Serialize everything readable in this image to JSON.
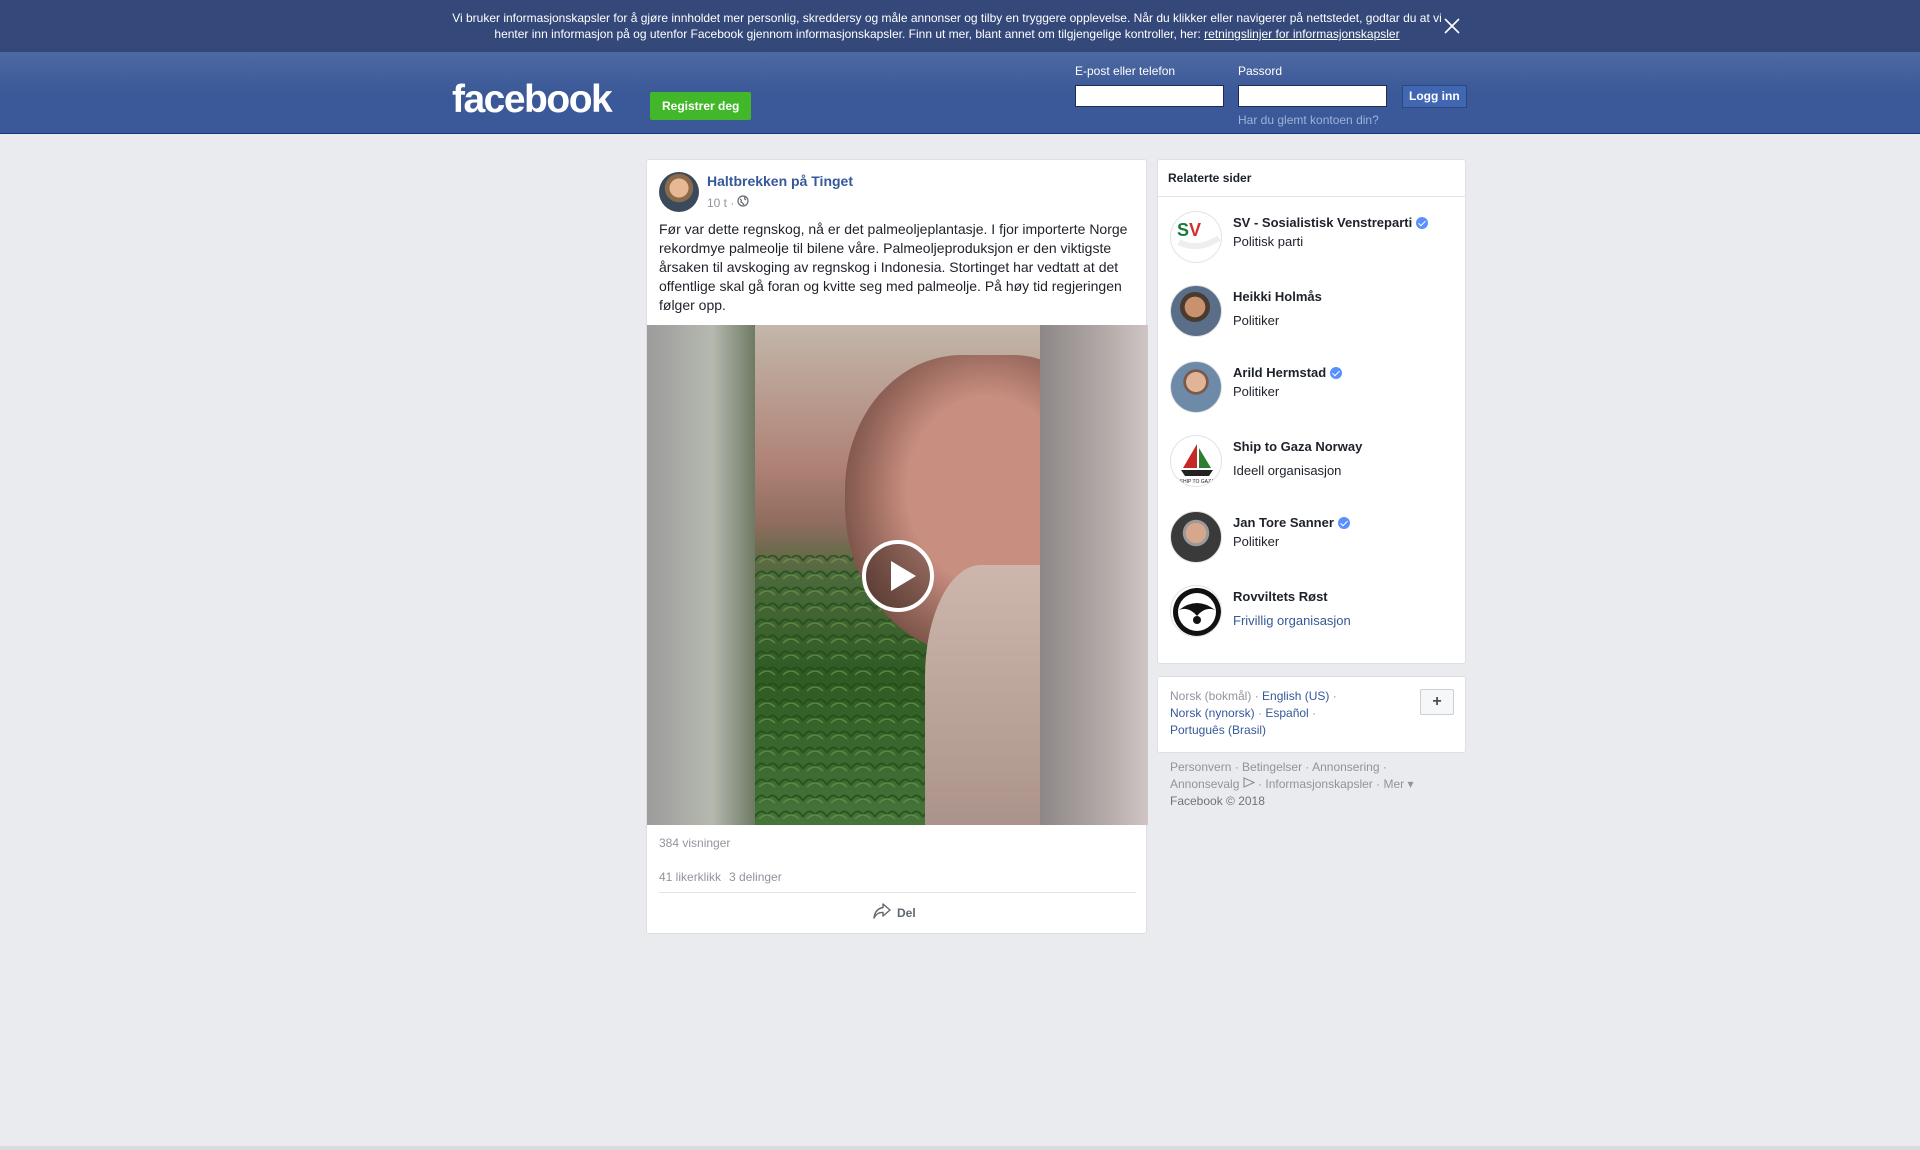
{
  "cookie_banner": {
    "text": "Vi bruker informasjonskapsler for å gjøre innholdet mer personlig, skreddersy og måle annonser og tilby en tryggere opplevelse. Når du klikker eller navigerer på nettstedet, godtar du at vi henter inn informasjon på og utenfor Facebook gjennom informasjonskapsler. Finn ut mer, blant annet om tilgjengelige kontroller, her: ",
    "link": "retningslinjer for informasjonskapsler"
  },
  "header": {
    "logo": "facebook",
    "register_label": "Registrer deg",
    "email_label": "E-post eller telefon",
    "password_label": "Passord",
    "login_label": "Logg inn",
    "forgot_label": "Har du glemt kontoen din?"
  },
  "post": {
    "author": "Haltbrekken på Tinget",
    "time": "10 t ·",
    "text": "Før var dette regnskog, nå er det palmeoljeplantasje. I fjor importerte Norge rekordmye palmeolje til bilene våre. Palmeoljeproduksjon er den viktigste årsaken til avskoging av regnskog i Indonesia. Stortinget har vedtatt at det offentlige skal gå foran og kvitte seg med palmeolje. På høy tid regjeringen følger opp.",
    "views": "384 visninger",
    "likes": "41 likerklikk",
    "shares": "3 delinger",
    "share_label": "Del"
  },
  "related": {
    "title": "Relaterte sider",
    "items": [
      {
        "name": "SV - Sosialistisk Venstreparti",
        "sub": "Politisk parti",
        "verified": true
      },
      {
        "name": "Heikki Holmås",
        "sub": "Politiker",
        "verified": false
      },
      {
        "name": "Arild Hermstad",
        "sub": "Politiker",
        "verified": true
      },
      {
        "name": "Ship to Gaza Norway",
        "sub": "Ideell organisasjon",
        "verified": false
      },
      {
        "name": "Jan Tore Sanner",
        "sub": "Politiker",
        "verified": true
      },
      {
        "name": "Rovviltets Røst",
        "sub": "Frivillig organisasjon",
        "verified": false
      }
    ]
  },
  "languages": {
    "current": "Norsk (bokmål)",
    "english": "English (US)",
    "nynorsk": "Norsk (nynorsk)",
    "espanol": "Español",
    "portugues": "Português (Brasil)",
    "plus": "+"
  },
  "footer": {
    "personvern": "Personvern",
    "betingelser": "Betingelser",
    "annonsering": "Annonsering",
    "annonsevalg": "Annonsevalg",
    "informasjonskapsler": "Informasjonskapsler",
    "mer": "Mer",
    "copyright": "Facebook © 2018"
  }
}
